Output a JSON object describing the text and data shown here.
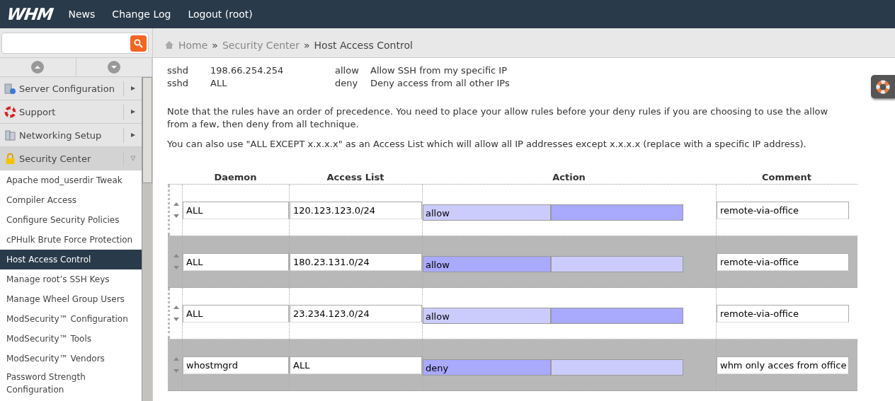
{
  "header": {
    "logo": "WHM",
    "nav": [
      "News",
      "Change Log",
      "Logout (root)"
    ]
  },
  "sidebar": {
    "groups": [
      {
        "label": "Server Configuration",
        "expanded": false
      },
      {
        "label": "Support",
        "expanded": false
      },
      {
        "label": "Networking Setup",
        "expanded": false
      },
      {
        "label": "Security Center",
        "expanded": true
      }
    ],
    "items": [
      {
        "label": "Apache mod_userdir Tweak",
        "selected": false
      },
      {
        "label": "Compiler Access",
        "selected": false
      },
      {
        "label": "Configure Security Policies",
        "selected": false
      },
      {
        "label": "cPHulk Brute Force Protection",
        "selected": false
      },
      {
        "label": "Host Access Control",
        "selected": true
      },
      {
        "label": "Manage root’s SSH Keys",
        "selected": false
      },
      {
        "label": "Manage Wheel Group Users",
        "selected": false
      },
      {
        "label": "ModSecurity™ Configuration",
        "selected": false
      },
      {
        "label": "ModSecurity™ Tools",
        "selected": false
      },
      {
        "label": "ModSecurity™ Vendors",
        "selected": false
      },
      {
        "label": "Password Strength Configuration",
        "selected": false
      }
    ]
  },
  "breadcrumb": [
    {
      "label": "Home"
    },
    {
      "separator": "»",
      "label": "Security Center"
    },
    {
      "separator": "»",
      "label": "Host Access Control"
    }
  ],
  "examples": [
    {
      "daemon": "sshd",
      "access_list": "198.66.254.254",
      "action": "allow",
      "comment": "Allow SSH from my specific IP"
    },
    {
      "daemon": "sshd",
      "access_list": "ALL",
      "action": "deny",
      "comment": "Deny access from all other IPs"
    }
  ],
  "notes": [
    "Note that the rules have an order of precedence. You need to place your allow rules before your deny rules if you are choosing to use the allow from a few, then deny from all technique.",
    "You can also use \"ALL EXCEPT x.x.x.x\" as an Access List which will allow all IP addresses except x.x.x.x (replace with a specific IP address)."
  ],
  "table": {
    "columns": [
      "Daemon",
      "Access List",
      "Action",
      "Comment"
    ],
    "rows": [
      {
        "daemon": "ALL",
        "access_list": "120.123.123.0/24",
        "action": "allow",
        "label_segment_selected": false,
        "comment": "remote-via-office"
      },
      {
        "daemon": "ALL",
        "access_list": "180.23.131.0/24",
        "action": "allow",
        "label_segment_selected": true,
        "comment": "remote-via-office"
      },
      {
        "daemon": "ALL",
        "access_list": "23.234.123.0/24",
        "action": "allow",
        "label_segment_selected": false,
        "comment": "remote-via-office"
      },
      {
        "daemon": "whostmgrd",
        "access_list": "ALL",
        "action": "deny",
        "label_segment_selected": true,
        "comment": "whm only acces from office"
      }
    ]
  }
}
